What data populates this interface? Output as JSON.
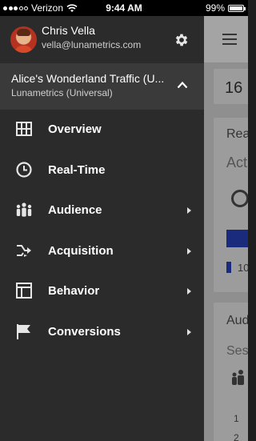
{
  "status_bar": {
    "carrier": "Verizon",
    "time": "9:44 AM",
    "battery": "99%"
  },
  "account": {
    "name": "Chris Vella",
    "email": "vella@lunametrics.com"
  },
  "property": {
    "name": "Alice's Wonderland Traffic (U...",
    "account": "Lunametrics (Universal)"
  },
  "nav": {
    "items": [
      {
        "label": "Overview",
        "icon": "grid-icon",
        "has_submenu": false
      },
      {
        "label": "Real-Time",
        "icon": "clock-icon",
        "has_submenu": false
      },
      {
        "label": "Audience",
        "icon": "people-icon",
        "has_submenu": true
      },
      {
        "label": "Acquisition",
        "icon": "merge-arrows-icon",
        "has_submenu": true
      },
      {
        "label": "Behavior",
        "icon": "layout-icon",
        "has_submenu": true
      },
      {
        "label": "Conversions",
        "icon": "flag-icon",
        "has_submenu": true
      }
    ]
  },
  "main": {
    "card1_value": "16",
    "card2_title": "Rea",
    "card2_subtitle": "Act",
    "card2_legend_value": "10",
    "card3_title": "Aud",
    "card3_subtitle": "Ses",
    "card3_tick1": "1",
    "card3_tick2": "2"
  },
  "colors": {
    "drawer_bg": "#2b2b2b",
    "property_bg": "#3a3a3a",
    "chart_blue": "#1a2a7c"
  }
}
